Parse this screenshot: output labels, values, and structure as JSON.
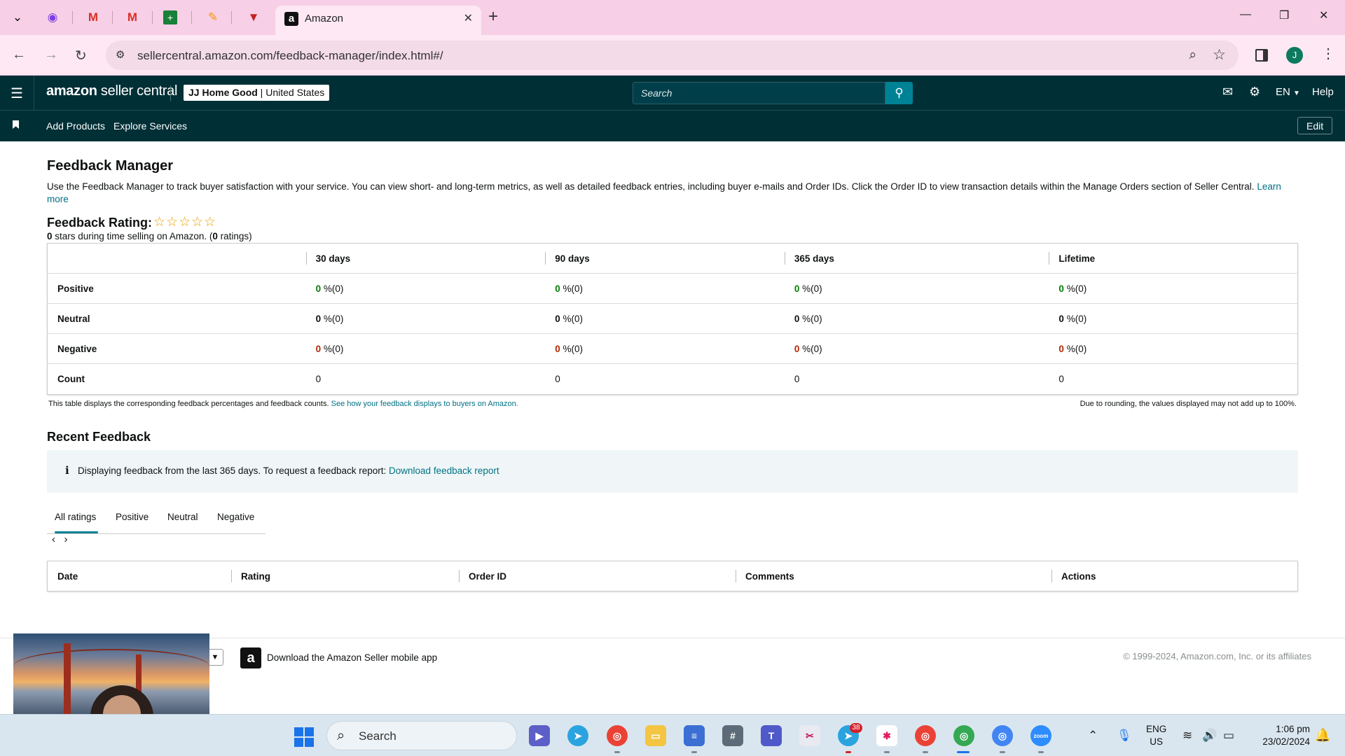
{
  "browser": {
    "active_tab_title": "Amazon",
    "url": "sellercentral.amazon.com/feedback-manager/index.html#/",
    "profile_initial": "J"
  },
  "header": {
    "logo_text_bold": "amazon",
    "logo_text_rest": " seller central",
    "store_name": "JJ Home Good",
    "store_region": " | United States",
    "search_placeholder": "Search",
    "language": "EN",
    "help": "Help"
  },
  "subnav": {
    "add_products": "Add Products",
    "explore_services": "Explore Services",
    "edit": "Edit"
  },
  "page": {
    "title": "Feedback Manager",
    "intro": "Use the Feedback Manager to track buyer satisfaction with your service. You can view short- and long-term metrics, as well as detailed feedback entries, including buyer e-mails and Order IDs. Click the Order ID to view transaction details within the Manage Orders section of Seller Central.",
    "learn_more": "Learn more",
    "rating_label": "Feedback Rating:",
    "stars": "☆☆☆☆☆",
    "rating_stars_value": "0",
    "rating_sub_mid": " stars during time selling on Amazon. (",
    "rating_count": "0",
    "rating_sub_end": " ratings)"
  },
  "feedback_table": {
    "headers": [
      "",
      "30 days",
      "90 days",
      "365 days",
      "Lifetime"
    ],
    "rows": [
      {
        "label": "Positive",
        "values": [
          "0",
          "0",
          "0",
          "0"
        ],
        "suffix": " %(0)"
      },
      {
        "label": "Neutral",
        "values": [
          "0",
          "0",
          "0",
          "0"
        ],
        "suffix": " %(0)"
      },
      {
        "label": "Negative",
        "values": [
          "0",
          "0",
          "0",
          "0"
        ],
        "suffix": " %(0)"
      },
      {
        "label": "Count",
        "values": [
          "0",
          "0",
          "0",
          "0"
        ]
      }
    ],
    "note": "This table displays the corresponding feedback percentages and feedback counts.",
    "note_link": "See how your feedback displays to buyers on Amazon.",
    "rounding_note": "Due to rounding, the values displayed may not add up to 100%."
  },
  "recent": {
    "title": "Recent Feedback",
    "info_icon": "i",
    "info_text": "Displaying feedback from the last 365 days. To request a feedback report:",
    "info_link": "Download feedback report",
    "tabs": [
      "All ratings",
      "Positive",
      "Neutral",
      "Negative"
    ],
    "columns": [
      "Date",
      "Rating",
      "Order ID",
      "Comments",
      "Actions"
    ]
  },
  "footer": {
    "app_text": "Download the Amazon Seller mobile app",
    "copyright": "© 1999-2024, Amazon.com, Inc. or its affiliates"
  },
  "taskbar": {
    "search_label": "Search",
    "telegram_badge": "38",
    "lang_line1": "ENG",
    "lang_line2": "US",
    "time": "1:06 pm",
    "date": "23/02/2024"
  },
  "colors": {
    "header_bg": "#002f36",
    "search_button": "#008296",
    "link": "#007185",
    "positive": "#067d06",
    "negative": "#b12704",
    "tabbar": "#f7cfe6"
  }
}
